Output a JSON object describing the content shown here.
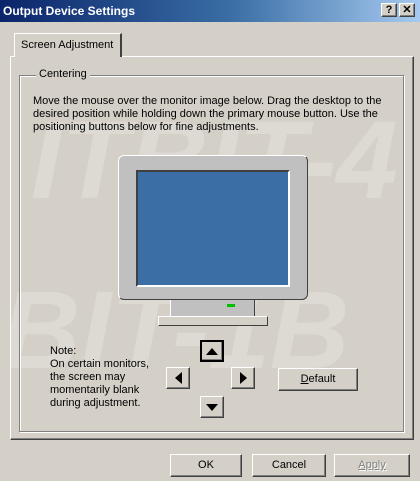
{
  "window": {
    "title": "Output Device Settings",
    "help_button": "?",
    "close_button": "✕"
  },
  "tabs": [
    {
      "label": "Screen Adjustment",
      "selected": true
    }
  ],
  "centering": {
    "group_label": "Centering",
    "instructions": "Move the mouse over the monitor image below. Drag the desktop to the desired position while holding down the primary mouse button. Use the positioning buttons below for fine adjustments."
  },
  "note": {
    "lines": [
      "Note:",
      "On certain monitors,",
      "the screen may",
      "momentarily blank",
      "during adjustment."
    ]
  },
  "buttons": {
    "default": {
      "prefix": "",
      "mnemonic": "D",
      "rest": "efault"
    },
    "ok": "OK",
    "cancel": "Cancel",
    "apply": "Apply"
  },
  "watermark": {
    "line1": "ITBIT-4",
    "line2": "BIT-1B"
  },
  "colors": {
    "titlebar_start": "#0a246a",
    "titlebar_end": "#a6caf0",
    "screen": "#3a6ea5",
    "face": "#d4d0c8"
  }
}
